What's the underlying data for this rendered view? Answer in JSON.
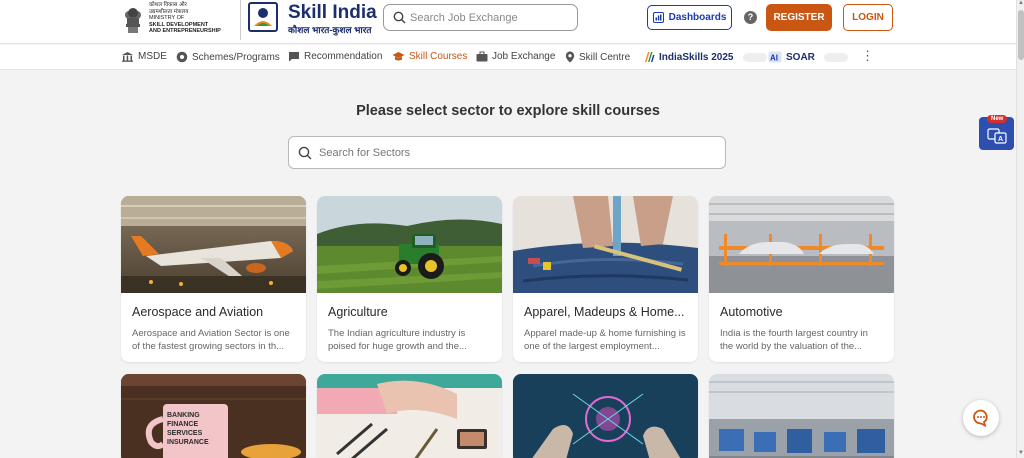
{
  "header": {
    "ministry_lines": [
      "कौशल विकास और",
      "उद्यमशीलता मंत्रालय",
      "MINISTRY OF",
      "SKILL DEVELOPMENT",
      "AND ENTREPRENEURSHIP"
    ],
    "brand_title": "Skill India",
    "brand_subtitle": "कौशल भारत-कुशल भारत",
    "search_placeholder": "Search Job Exchange",
    "dashboards_label": "Dashboards",
    "help_label": "?",
    "register_label": "REGISTER",
    "login_label": "LOGIN"
  },
  "nav": {
    "items": [
      {
        "label": "MSDE",
        "icon": "building-icon"
      },
      {
        "label": "Schemes/Programs",
        "icon": "gear-badge-icon"
      },
      {
        "label": "Recommendation",
        "icon": "message-icon"
      },
      {
        "label": "Skill Courses",
        "icon": "graduation-cap-icon"
      },
      {
        "label": "Job Exchange",
        "icon": "briefcase-icon"
      },
      {
        "label": "Skill Centre",
        "icon": "location-pin-icon"
      },
      {
        "label": "IndiaSkills 2025",
        "icon": "indiaskills-logo-icon"
      },
      {
        "label": "SOAR",
        "icon": "ai-icon"
      }
    ],
    "more_label": "⋮"
  },
  "main": {
    "title": "Please select sector to explore skill courses",
    "sector_search_placeholder": "Search for Sectors",
    "cards": [
      {
        "title": "Aerospace and Aviation",
        "desc": "Aerospace and Aviation Sector is one of the fastest growing sectors in th..."
      },
      {
        "title": "Agriculture",
        "desc": "The Indian agriculture industry is poised for huge growth and the..."
      },
      {
        "title": "Apparel, Madeups & Home...",
        "desc": "Apparel made-up & home furnishing is one of the largest employment..."
      },
      {
        "title": "Automotive",
        "desc": "India is the fourth largest country in the world by the valuation of the..."
      }
    ],
    "mug_text": [
      "BANKING",
      "FINANCE",
      "SERVICES",
      "INSURANCE"
    ]
  },
  "floating": {
    "new_label": "New"
  },
  "colors": {
    "brand_navy": "#1c2e6e",
    "accent_orange": "#c95612",
    "link_blue": "#1c3aa9"
  }
}
